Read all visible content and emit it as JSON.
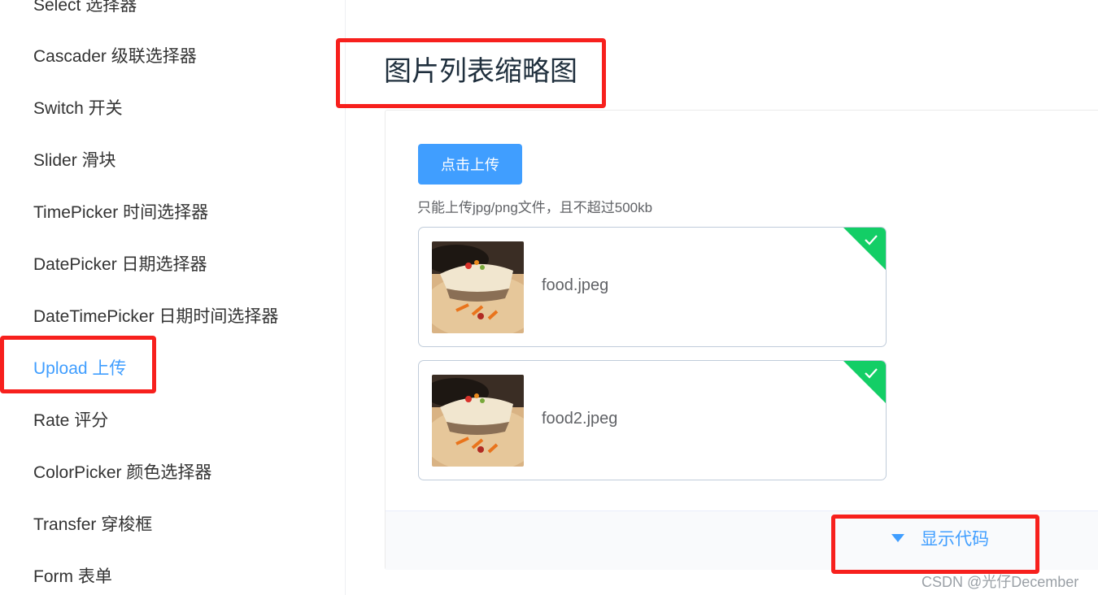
{
  "sidebar": {
    "items": [
      {
        "label": "Select 选择器"
      },
      {
        "label": "Cascader 级联选择器"
      },
      {
        "label": "Switch 开关"
      },
      {
        "label": "Slider 滑块"
      },
      {
        "label": "TimePicker 时间选择器"
      },
      {
        "label": "DatePicker 日期选择器"
      },
      {
        "label": "DateTimePicker 日期时间选择器"
      },
      {
        "label": "Upload 上传",
        "active": true
      },
      {
        "label": "Rate 评分"
      },
      {
        "label": "ColorPicker 颜色选择器"
      },
      {
        "label": "Transfer 穿梭框"
      },
      {
        "label": "Form 表单"
      }
    ]
  },
  "main": {
    "title": "图片列表缩略图",
    "demo": {
      "upload_button": "点击上传",
      "tip": "只能上传jpg/png文件，且不超过500kb",
      "files": [
        {
          "name": "food.jpeg",
          "status": "success"
        },
        {
          "name": "food2.jpeg",
          "status": "success"
        }
      ],
      "show_code": "显示代码"
    }
  },
  "watermark": "CSDN @光仔December",
  "colors": {
    "accent": "#409eff",
    "success": "#13ce66",
    "annotation": "#f7201d",
    "text": "#333333"
  },
  "icons": [
    "check-icon",
    "caret-down-icon"
  ]
}
